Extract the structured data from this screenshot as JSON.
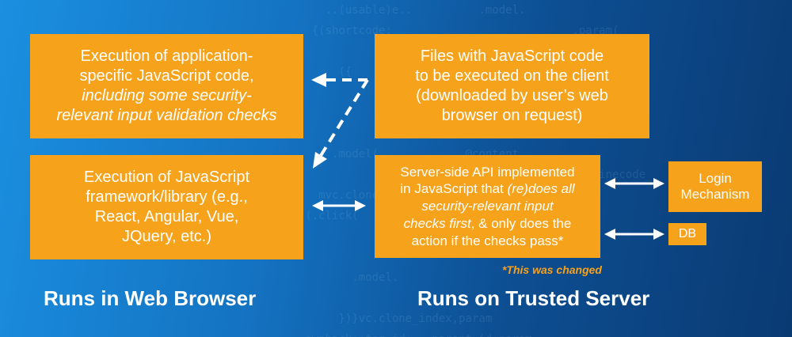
{
  "boxes": {
    "app_execution": {
      "line1": "Execution of application-",
      "line2": "specific JavaScript code,",
      "line3": "including some security-",
      "line4": "relevant input validation checks"
    },
    "files": {
      "line1": "Files with JavaScript code",
      "line2": "to be executed on the client",
      "line3": "(downloaded by user’s web",
      "line4": "browser on request)"
    },
    "framework": {
      "line1": "Execution of JavaScript",
      "line2": "framework/library (e.g.,",
      "line3": "React, Angular, Vue,",
      "line4": "JQuery, etc.)"
    },
    "server_api": {
      "line1": "Server-side API implemented",
      "line2a": "in JavaScript that ",
      "line2b": "(re)does all",
      "line3": "security-relevant input",
      "line4a": "checks first",
      "line4b": ", & only does the",
      "line5": "action if the checks pass*"
    },
    "login": {
      "line1": "Login",
      "line2": "Mechanism"
    },
    "db": {
      "label": "DB"
    }
  },
  "note": "*This was changed",
  "footer": {
    "left": "Runs in Web Browser",
    "right": "Runs on Trusted Server"
  },
  "colors": {
    "box": "#f7a21b",
    "text": "#ffffff",
    "background": "#1473c2"
  }
}
